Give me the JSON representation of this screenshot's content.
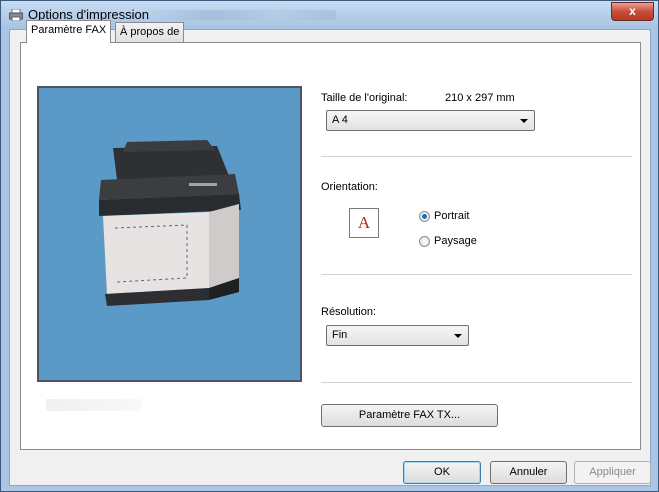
{
  "window": {
    "title": "Options d'impression",
    "close_label": "x"
  },
  "tabs": [
    {
      "label": "Paramètre FAX",
      "active": true
    },
    {
      "label": "À propos de",
      "active": false
    }
  ],
  "original_size": {
    "label": "Taille de l'original:",
    "value": "210 x 297 mm",
    "selected": "A 4"
  },
  "orientation": {
    "label": "Orientation:",
    "icon_letter": "A",
    "options": [
      "Portrait",
      "Paysage"
    ],
    "selected": "Portrait"
  },
  "resolution": {
    "label": "Résolution:",
    "selected": "Fin"
  },
  "fax_tx_button": "Paramètre FAX TX...",
  "footer": {
    "ok": "OK",
    "cancel": "Annuler",
    "apply": "Appliquer"
  },
  "colors": {
    "preview_bg": "#5b9ac6",
    "radio_dot": "#1f6fc5",
    "close_red": "#c74f3b"
  }
}
